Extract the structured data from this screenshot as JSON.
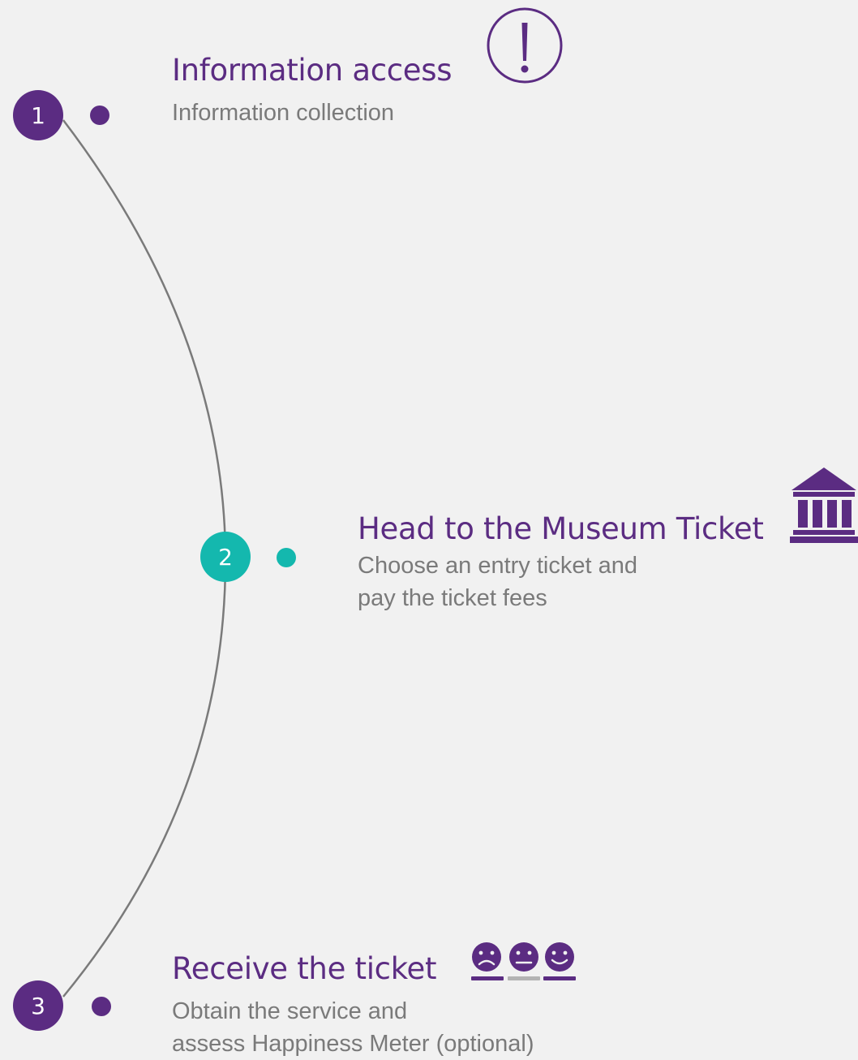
{
  "colors": {
    "purple": "#5b2c82",
    "teal": "#14b8ae",
    "line": "#7a7a7a",
    "text_gray": "#7a7a7a",
    "meter_gray": "#b3b3b3",
    "background": "#f1f1f1"
  },
  "steps": [
    {
      "number": "1",
      "title": "Information access",
      "description": [
        "Information collection"
      ],
      "icon": "exclamation-circle-icon",
      "badge_color": "#5b2c82"
    },
    {
      "number": "2",
      "title": "Head to the Museum Ticket",
      "description": [
        "Choose an entry ticket and",
        "pay the ticket fees"
      ],
      "icon": "museum-icon",
      "badge_color": "#14b8ae"
    },
    {
      "number": "3",
      "title": "Receive the ticket",
      "description": [
        "Obtain the service and",
        "assess Happiness  Meter (optional)"
      ],
      "icon": "happiness-meter-icon",
      "badge_color": "#5b2c82"
    }
  ]
}
